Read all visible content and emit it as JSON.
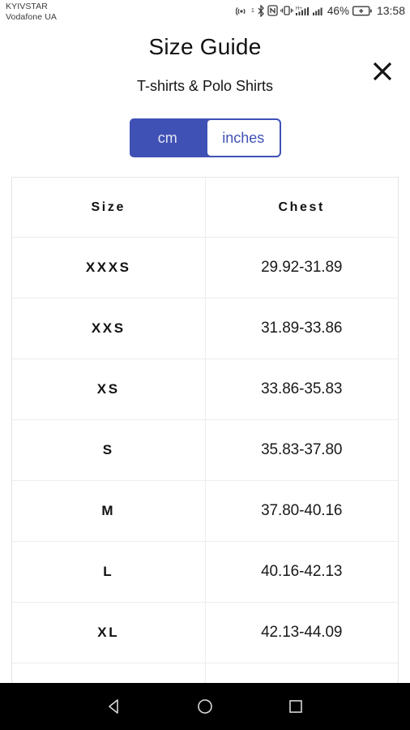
{
  "statusbar": {
    "carrier_primary": "KYIVSTAR",
    "carrier_secondary": "Vodafone UA",
    "hotspot_superscript": "1",
    "battery_percent": "46%",
    "clock": "13:58",
    "icons": [
      "hotspot-icon",
      "bluetooth-icon",
      "nfc-icon",
      "vibrate-icon",
      "hplus-signal-icon",
      "signal-bars-icon",
      "battery-icon"
    ]
  },
  "header": {
    "title": "Size Guide",
    "subtitle": "T-shirts & Polo Shirts",
    "close_label": "close-icon"
  },
  "unit_toggle": {
    "options": [
      "cm",
      "inches"
    ],
    "selected": "inches",
    "accent_color": "#3f51b5",
    "inactive_text_color": "#e3e6f3"
  },
  "table": {
    "columns": [
      "Size",
      "Chest"
    ],
    "rows": [
      {
        "size": "XXXS",
        "chest": "29.92-31.89"
      },
      {
        "size": "XXS",
        "chest": "31.89-33.86"
      },
      {
        "size": "XS",
        "chest": "33.86-35.83"
      },
      {
        "size": "S",
        "chest": "35.83-37.80"
      },
      {
        "size": "M",
        "chest": "37.80-40.16"
      },
      {
        "size": "L",
        "chest": "40.16-42.13"
      },
      {
        "size": "XL",
        "chest": "42.13-44.09"
      }
    ]
  },
  "navbar": {
    "back_label": "back-icon",
    "home_label": "home-icon",
    "recents_label": "recents-icon"
  }
}
